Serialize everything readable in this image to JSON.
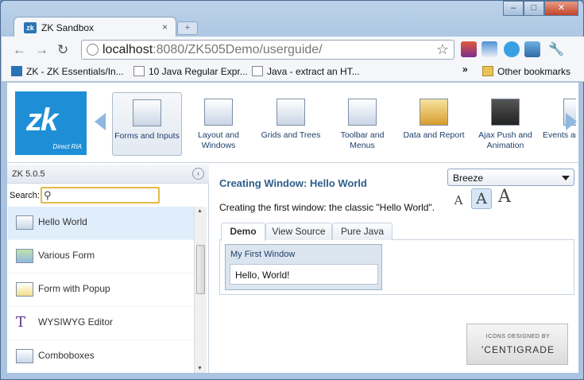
{
  "browser": {
    "tab_title": "ZK Sandbox",
    "tab_close": "×",
    "new_tab": "+",
    "url_host": "localhost",
    "url_rest": ":8080/ZK505Demo/userguide/",
    "back": "←",
    "forward": "→",
    "reload": "↻",
    "star": "☆",
    "win_min": "–",
    "win_max": "□",
    "win_close": "✕"
  },
  "bookmarks": {
    "items": [
      {
        "label": "ZK - ZK Essentials/In..."
      },
      {
        "label": "10 Java Regular Expr..."
      },
      {
        "label": "Java - extract an HT..."
      }
    ],
    "overflow": "»",
    "other": "Other bookmarks"
  },
  "ribbon": {
    "logo_text": "zk",
    "logo_sub": "Direct RIA",
    "items": [
      {
        "label": "Forms and Inputs"
      },
      {
        "label": "Layout and Windows"
      },
      {
        "label": "Grids and Trees"
      },
      {
        "label": "Toolbar and Menus"
      },
      {
        "label": "Data and Report"
      },
      {
        "label": "Ajax Push and Animation"
      },
      {
        "label": "Events an"
      }
    ]
  },
  "sidebar": {
    "title": "ZK 5.0.5",
    "collapse": "‹",
    "search_label": "Search:",
    "items": [
      {
        "label": "Hello World"
      },
      {
        "label": "Various Form"
      },
      {
        "label": "Form with Popup"
      },
      {
        "label": "WYSIWYG Editor"
      },
      {
        "label": "Comboboxes"
      }
    ]
  },
  "main": {
    "title": "Creating Window: Hello World",
    "description": "Creating the first window: the classic \"Hello World\".",
    "theme": "Breeze",
    "font_sizes": [
      "A",
      "A",
      "A"
    ],
    "tabs": [
      {
        "label": "Demo"
      },
      {
        "label": "View Source"
      },
      {
        "label": "Pure Java"
      }
    ],
    "window_title": "My First Window",
    "window_body": "Hello, World!",
    "credit_line1": "ICONS DESIGNED BY",
    "credit_line2": "'CENTIGRADE"
  },
  "colors": {
    "accent": "#2f5d8a",
    "logo": "#1e8fd6",
    "selected_row": "#dfeefa"
  }
}
